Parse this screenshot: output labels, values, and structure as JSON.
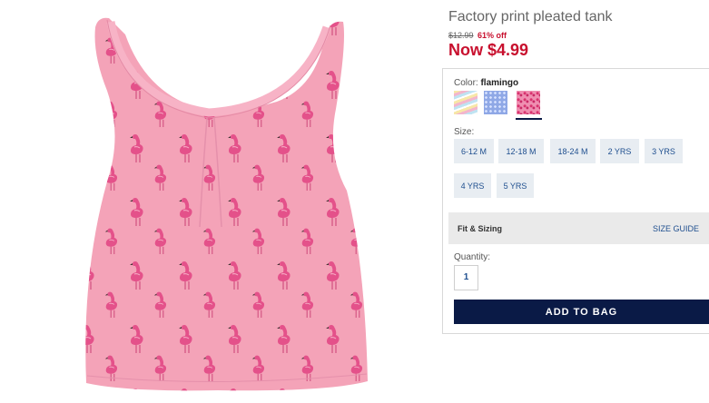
{
  "product": {
    "title": "Factory print pleated tank",
    "price_old": "$12.99",
    "price_off": "61% off",
    "price_now": "Now $4.99"
  },
  "color": {
    "label": "Color:",
    "selected": "flamingo",
    "swatches": [
      "multi-stripe",
      "blue-dot",
      "flamingo"
    ]
  },
  "size": {
    "label": "Size:",
    "options": [
      "6-12 M",
      "12-18 M",
      "18-24 M",
      "2 YRS",
      "3 YRS",
      "4 YRS",
      "5 YRS"
    ]
  },
  "fit": {
    "title": "Fit & Sizing",
    "size_guide": "SIZE GUIDE"
  },
  "quantity": {
    "label": "Quantity:",
    "value": "1"
  },
  "add_to_bag": "ADD TO BAG",
  "colors": {
    "sale_red": "#c8102e",
    "navy": "#0a1a46",
    "link_blue": "#1f4f8f",
    "tank_pink": "#f4a3b8",
    "flamingo_pink": "#e34d88"
  }
}
